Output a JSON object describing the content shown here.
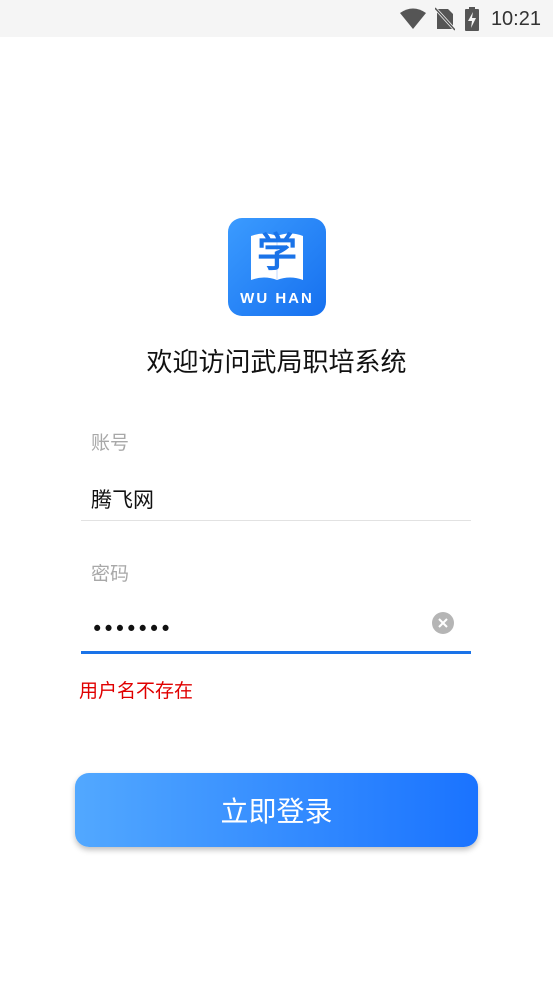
{
  "status_bar": {
    "time": "10:21",
    "icons": [
      "wifi-icon",
      "no-sim-icon",
      "battery-charging-icon"
    ]
  },
  "logo": {
    "glyph": "学",
    "text": "WU HAN",
    "colors": {
      "gradient_start": "#3b9bff",
      "gradient_end": "#1670ef"
    }
  },
  "welcome_title": "欢迎访问武局职培系统",
  "form": {
    "account": {
      "label": "账号",
      "value": "腾飞网"
    },
    "password": {
      "label": "密码",
      "value": "•••••••"
    },
    "error_message": "用户名不存在"
  },
  "login_button": {
    "label": "立即登录"
  },
  "colors": {
    "accent": "#1a73e8",
    "error": "#e00000",
    "button_start": "#52a8ff",
    "button_end": "#1a73ff"
  }
}
